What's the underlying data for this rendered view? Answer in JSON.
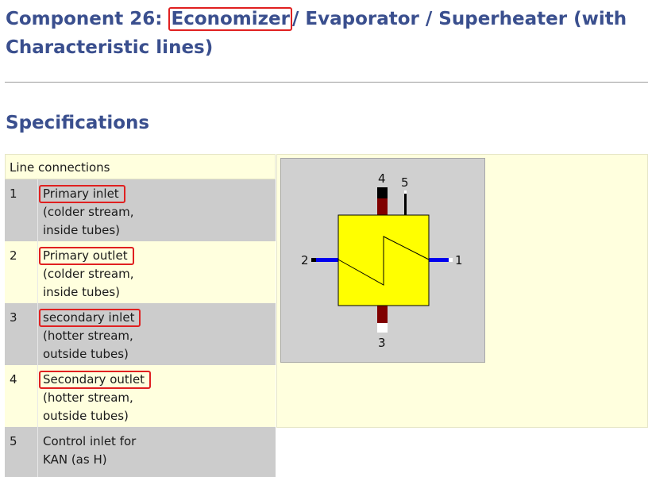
{
  "page": {
    "title_prefix": "Component 26: ",
    "title_highlight": "Economizer",
    "title_suffix": "/ Evaporator / Superheater (with Characteristic lines)",
    "section_heading": "Specifications"
  },
  "table": {
    "header": "Line connections",
    "rows": [
      {
        "num": "1",
        "name": "Primary inlet",
        "line2": "(colder stream,",
        "line3": "inside tubes)"
      },
      {
        "num": "2",
        "name": "Primary outlet",
        "line2": "(colder stream,",
        "line3": "inside tubes)"
      },
      {
        "num": "3",
        "name": "secondary inlet",
        "line2": "(hotter stream,",
        "line3": "outside tubes)"
      },
      {
        "num": "4",
        "name": "Secondary outlet",
        "line2": "(hotter stream,",
        "line3": "outside tubes)"
      },
      {
        "num": "5",
        "name": "Control inlet for",
        "line2": "KAN (as H)"
      }
    ]
  },
  "diagram": {
    "labels": {
      "c1": "1",
      "c2": "2",
      "c3": "3",
      "c4": "4",
      "c5": "5"
    },
    "colors": {
      "body": "#ffff00",
      "primary_line": "#0000ee",
      "secondary_line": "#800000",
      "background": "#d0d0d0"
    }
  },
  "colors": {
    "heading": "#3a4f8e",
    "highlight_box": "#e02020",
    "row_gray": "#cccccc",
    "row_yellow": "#ffffde"
  }
}
